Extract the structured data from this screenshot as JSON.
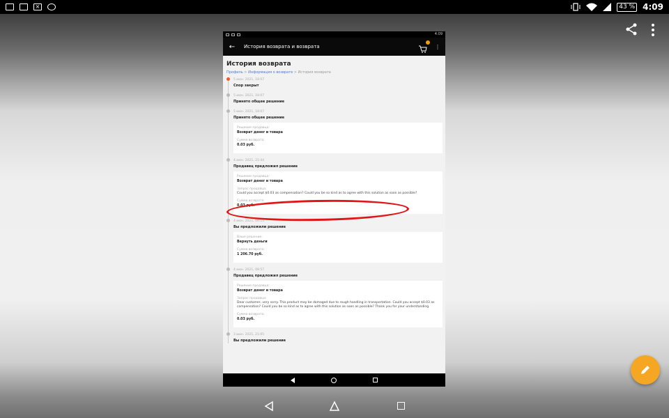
{
  "status_bar": {
    "battery": "43 %",
    "time": "4:09",
    "left_icons": [
      "image-icon",
      "cast-icon",
      "x-app-icon",
      "vpn-icon"
    ],
    "right_icons": [
      "vibrate-icon",
      "wifi-icon",
      "signal-icon"
    ]
  },
  "viewer": {
    "actions": [
      "share-icon",
      "more-vert-icon"
    ],
    "fab_icon": "pencil-icon",
    "fab_color": "#f5a623",
    "annotation_color": "#e01616"
  },
  "phone": {
    "status_time": "4:09",
    "appbar_title": "История возврата и возврата",
    "page_title": "История возврата",
    "breadcrumb": {
      "items": [
        "Профиль",
        "Информация о возврате",
        "История возврата"
      ],
      "separator": ">"
    },
    "timeline": [
      {
        "date": "5 июн. 2021, 18:07",
        "title": "Спор закрыт",
        "active": true
      },
      {
        "date": "5 июн. 2021, 18:07",
        "title": "Принято общее решение"
      },
      {
        "date": "5 июн. 2021, 18:07",
        "title": "Принято общее решение",
        "card": [
          {
            "label": "Решение продавца:",
            "value": "Возврат денег и товара"
          },
          {
            "label": "Сумма возврата:",
            "value": "0.03 руб."
          }
        ]
      },
      {
        "date": "4 июн. 2021, 21:44",
        "title": "Продавец предложил решение",
        "card": [
          {
            "label": "Решение продавца:",
            "value": "Возврат денег и товара"
          },
          {
            "label": "Запрос продавца:",
            "text": "Could you accept $0.03 as compensation? Could you be so kind as to agree with this solution as soon as possible?"
          },
          {
            "label": "Сумма возврата:",
            "value": "0.03 руб."
          }
        ]
      },
      {
        "date": "4 июн. 2021, 09:15",
        "title": "Вы предложили решение",
        "card": [
          {
            "label": "Ваше решение:",
            "value": "Вернуть деньги"
          },
          {
            "label": "Сумма возврата:",
            "value": "1 206.70 руб."
          }
        ]
      },
      {
        "date": "4 июн. 2021, 08:57",
        "title": "Продавец предложил решение",
        "card": [
          {
            "label": "Решение продавца:",
            "value": "Возврат денег и товара"
          },
          {
            "label": "Запрос продавца:",
            "text": "Dear customer, very sorry. This product may be damaged due to rough handling in transportation. Could you accept $0.03 as compensation? Could you be so kind as to agree with this solution as soon as possible? Thank you for your understanding."
          },
          {
            "label": "Сумма возврата:",
            "value": "0.03 руб."
          }
        ]
      },
      {
        "date": "3 июн. 2021, 21:05",
        "title": "Вы предложили решение"
      }
    ]
  }
}
